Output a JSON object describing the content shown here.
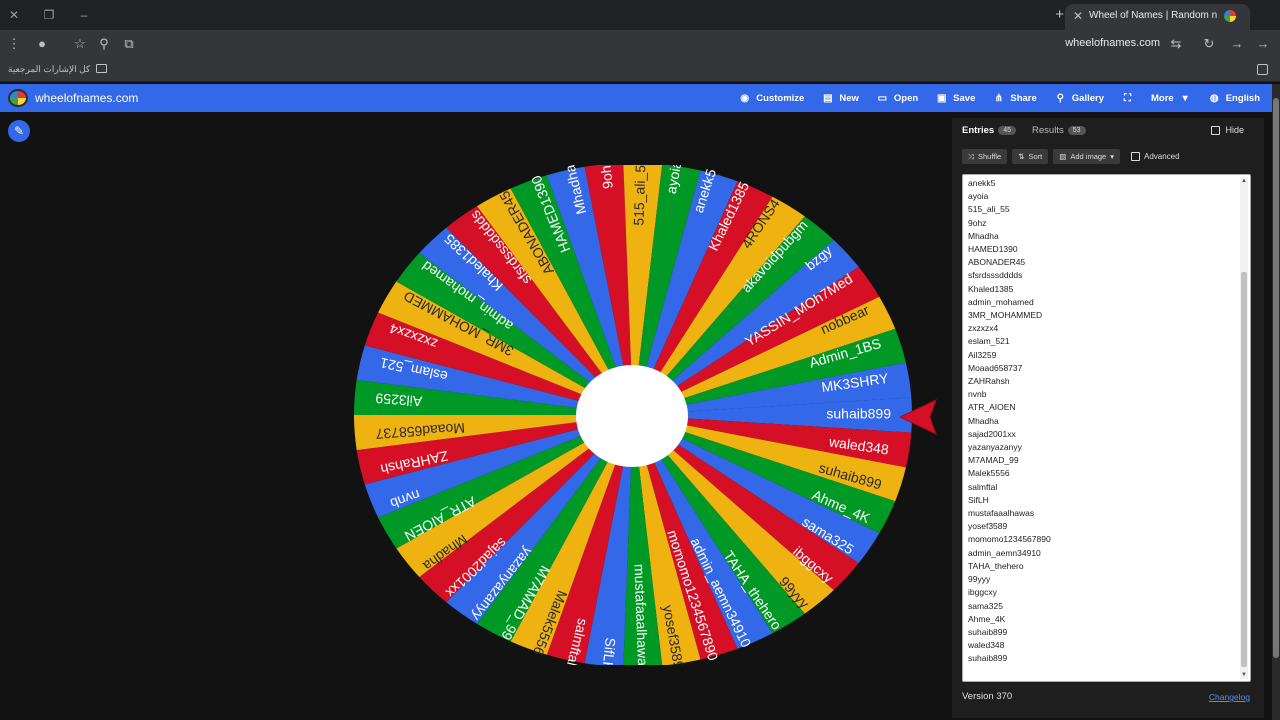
{
  "browser": {
    "tab_title": "Wheel of Names | Random name picker",
    "address": "wheelofnames.com",
    "bookmarks_label": "كل الإشارات المرجعية"
  },
  "header": {
    "site_name": "wheelofnames.com",
    "nav": [
      {
        "label": "Customize",
        "icon": "palette-icon"
      },
      {
        "label": "New",
        "icon": "file-icon"
      },
      {
        "label": "Open",
        "icon": "folder-icon"
      },
      {
        "label": "Save",
        "icon": "save-icon"
      },
      {
        "label": "Share",
        "icon": "share-icon"
      },
      {
        "label": "Gallery",
        "icon": "search-icon"
      },
      {
        "label": "",
        "icon": "fullscreen-icon"
      },
      {
        "label": "More",
        "icon": "chevron-down-icon"
      },
      {
        "label": "English",
        "icon": "globe-icon"
      }
    ]
  },
  "wheel": {
    "colors": [
      "#3369e8",
      "#d50f25",
      "#eeb211",
      "#009925"
    ],
    "labels": [
      "suhaib899",
      "waled348",
      "suhaib899",
      "Ahme_4K",
      "sama325",
      "ibggcxy",
      "99yyy",
      "TAHA_thehero",
      "admin_aemn34910",
      "momomo1234567890",
      "yosef3589",
      "mustafaaalhawas",
      "SifLH",
      "salmftal",
      "Malek5556",
      "M7AMAD_99",
      "yazanyazanyy",
      "sajad2001xx",
      "Mhadha",
      "ATR_AIOEN",
      "nvnb",
      "ZAHRahsh",
      "Moaad658737",
      "Ail3259",
      "eslam_521",
      "zxzxzx4",
      "3MR_MOHAMMED",
      "admin_mohamed",
      "Khaled1385",
      "sfsrdsssdddds",
      "ABONADER45",
      "HAMED1390",
      "Mhadha",
      "9ohz",
      "515_ali_55",
      "ayoia",
      "anekk5",
      "Khaled1385",
      "4RONS4",
      "akavoidpubgm",
      "bzgy",
      "YASSIN_MOh7Med",
      "nobbear",
      "Admin_1BS",
      "MK3SHRY"
    ]
  },
  "sidebar": {
    "entries_tab": "Entries",
    "entries_count": "45",
    "results_tab": "Results",
    "results_count": "53",
    "hide_label": "Hide",
    "shuffle_label": "Shuffle",
    "sort_label": "Sort",
    "add_image_label": "Add image",
    "advanced_label": "Advanced",
    "entries": [
      "anekk5",
      "ayoia",
      "515_ali_55",
      "9ohz",
      "Mhadha",
      "HAMED1390",
      "ABONADER45",
      "sfsrdsssdddds",
      "Khaled1385",
      "admin_mohamed",
      "3MR_MOHAMMED",
      "zxzxzx4",
      "eslam_521",
      "Ail3259",
      "Moaad658737",
      "ZAHRahsh",
      "nvnb",
      "ATR_AIOEN",
      "Mhadha",
      "sajad2001xx",
      "yazanyazanyy",
      "M7AMAD_99",
      "Malek5556",
      "salmftal",
      "SifLH",
      "mustafaaalhawas",
      "yosef3589",
      "momomo1234567890",
      "admin_aemn34910",
      "TAHA_thehero",
      "99yyy",
      "ibggcxy",
      "sama325",
      "Ahme_4K",
      "suhaib899",
      "waled348",
      "suhaib899"
    ],
    "version": "Version 370",
    "changelog": "Changelog"
  },
  "colors": {
    "header_blue": "#3369e8",
    "pointer_red": "#d50f25"
  }
}
